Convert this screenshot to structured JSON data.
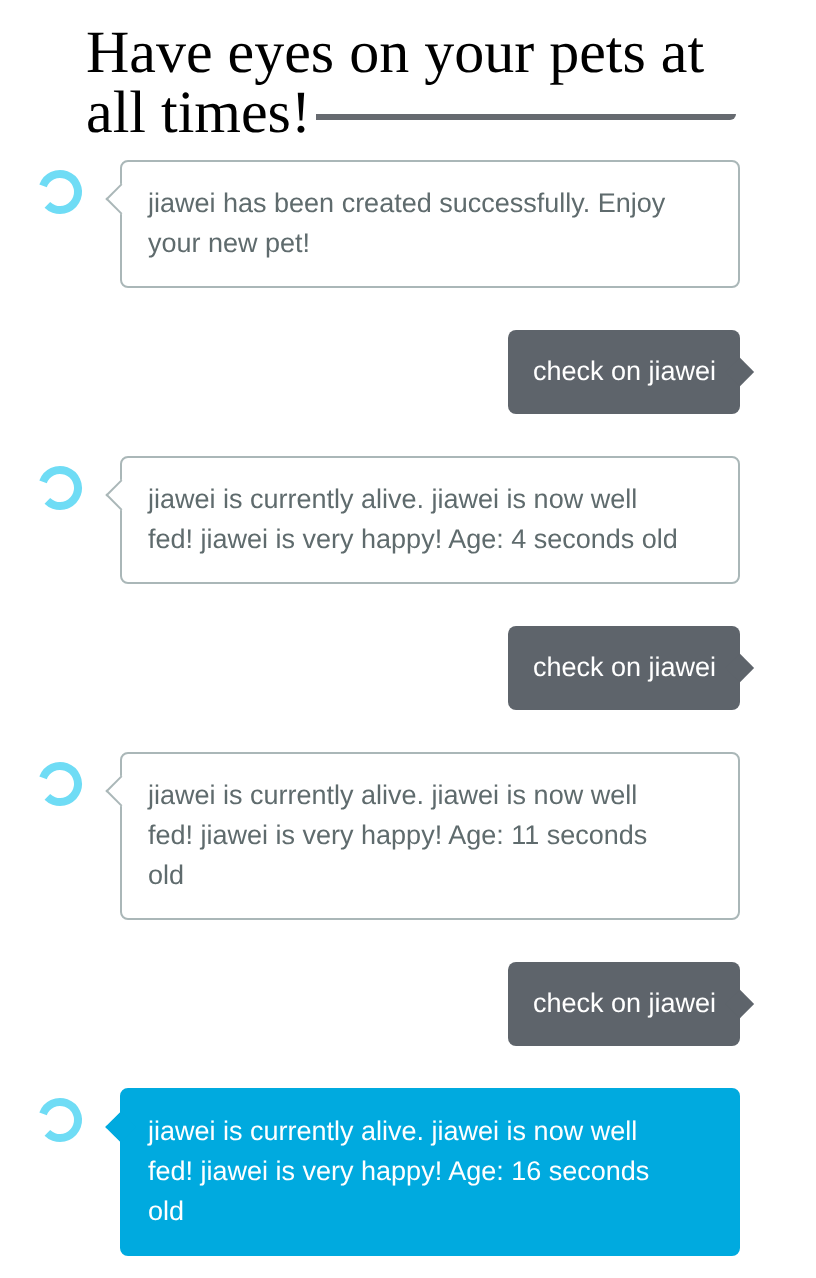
{
  "heading": "Have eyes on your pets at all times!",
  "messages": [
    {
      "kind": "alexa",
      "text": "jiawei has been created successfully. Enjoy your new pet!",
      "highlighted": false
    },
    {
      "kind": "user",
      "text": "check on jiawei"
    },
    {
      "kind": "alexa",
      "text": "jiawei is currently alive. jiawei is now well fed! jiawei is very happy! Age: 4 seconds old",
      "highlighted": false
    },
    {
      "kind": "user",
      "text": "check on jiawei"
    },
    {
      "kind": "alexa",
      "text": "jiawei is currently alive. jiawei is now well fed! jiawei is very happy! Age: 11 seconds old",
      "highlighted": false
    },
    {
      "kind": "user",
      "text": "check on jiawei"
    },
    {
      "kind": "alexa",
      "text": "jiawei is currently alive. jiawei is now well fed! jiawei is very happy! Age: 16 seconds old",
      "highlighted": true
    }
  ]
}
